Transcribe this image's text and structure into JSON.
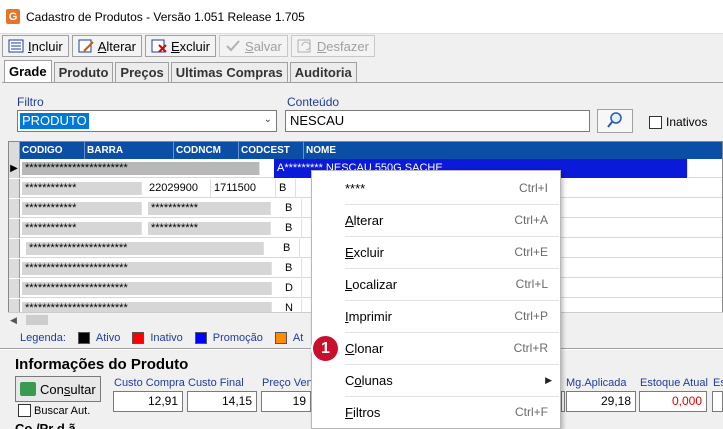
{
  "window": {
    "title": "Cadastro de Produtos - Versão 1.051 Release 1.705",
    "icon_letter": "G"
  },
  "toolbar": {
    "incluir": {
      "pre": "",
      "u": "I",
      "post": "ncluir"
    },
    "alterar": {
      "pre": "",
      "u": "A",
      "post": "lterar"
    },
    "excluir": {
      "pre": "",
      "u": "E",
      "post": "xcluir"
    },
    "salvar": {
      "pre": "",
      "u": "S",
      "post": "alvar"
    },
    "desfazer": {
      "pre": "",
      "u": "D",
      "post": "esfazer"
    }
  },
  "tabs": [
    "Grade",
    "Produto",
    "Preços",
    "Ultimas Compras",
    "Auditoria"
  ],
  "filter": {
    "filtro_label": "Filtro",
    "filtro_value": "PRODUTO",
    "conteudo_label": "Conteúdo",
    "conteudo_value": "NESCAU",
    "inativos_label": "Inativos"
  },
  "grid": {
    "columns": [
      "CODIGO",
      "BARRA",
      "CODNCM",
      "CODCEST",
      "NOME"
    ],
    "rows": [
      {
        "codigo": "************************",
        "barra": "",
        "codncm": "",
        "codcest": "",
        "nome": "A*********  NESCAU 550G SACHE"
      },
      {
        "codigo": "************",
        "barra": "",
        "codncm": "22029900",
        "codcest": "1711500",
        "nome": "B"
      },
      {
        "codigo": "************",
        "barra": "",
        "codncm": "***********",
        "codcest": "",
        "nome": "B"
      },
      {
        "codigo": "************",
        "barra": "",
        "codncm": "***********",
        "codcest": "",
        "nome": "B"
      },
      {
        "codigo": "***********************",
        "barra": "",
        "codncm": "",
        "codcest": "",
        "nome": "B"
      },
      {
        "codigo": "************************",
        "barra": "",
        "codncm": "",
        "codcest": "",
        "nome": "B"
      },
      {
        "codigo": "************************",
        "barra": "",
        "codncm": "",
        "codcest": "",
        "nome": "D"
      },
      {
        "codigo": "************************",
        "barra": "",
        "codncm": "",
        "codcest": "",
        "nome": "N"
      }
    ]
  },
  "legend": {
    "title": "Legenda:",
    "items": [
      {
        "label": "Ativo",
        "color": "#000000"
      },
      {
        "label": "Inativo",
        "color": "#ff0000"
      },
      {
        "label": "Promoção",
        "color": "#0000ff"
      },
      {
        "label": "At",
        "color": "#ff8c00"
      }
    ]
  },
  "info": {
    "title": "Informações do Produto",
    "consultar_pre": "Con",
    "consultar_u": "s",
    "consultar_post": "ultar",
    "buscar_label": "Buscar Aut.",
    "fields": [
      {
        "label": "Custo Compra",
        "value": "12,91"
      },
      {
        "label": "Custo Final",
        "value": "14,15"
      },
      {
        "label": "Preço Ven",
        "value": "19"
      },
      {
        "label": "Mg.Aplicada",
        "value": "29,18"
      },
      {
        "label": "Estoque Atual",
        "value": "0,000"
      },
      {
        "label": "Es",
        "value": ""
      }
    ],
    "bottom_text": "Co                         /Pr  d  ã"
  },
  "context_menu": {
    "items": [
      {
        "pre": "",
        "u": "",
        "post": "****",
        "shortcut": "Ctrl+I"
      },
      {
        "pre": "",
        "u": "A",
        "post": "lterar",
        "shortcut": "Ctrl+A"
      },
      {
        "pre": "",
        "u": "E",
        "post": "xcluir",
        "shortcut": "Ctrl+E"
      },
      {
        "pre": "",
        "u": "L",
        "post": "ocalizar",
        "shortcut": "Ctrl+L"
      },
      {
        "pre": "",
        "u": "I",
        "post": "mprimir",
        "shortcut": "Ctrl+P"
      },
      {
        "pre": "",
        "u": "C",
        "post": "lonar",
        "shortcut": "Ctrl+R"
      },
      {
        "pre": "C",
        "u": "o",
        "post": "lunas",
        "shortcut": ""
      },
      {
        "pre": "",
        "u": "F",
        "post": "iltros",
        "shortcut": "Ctrl+F"
      }
    ],
    "badge": "1"
  }
}
